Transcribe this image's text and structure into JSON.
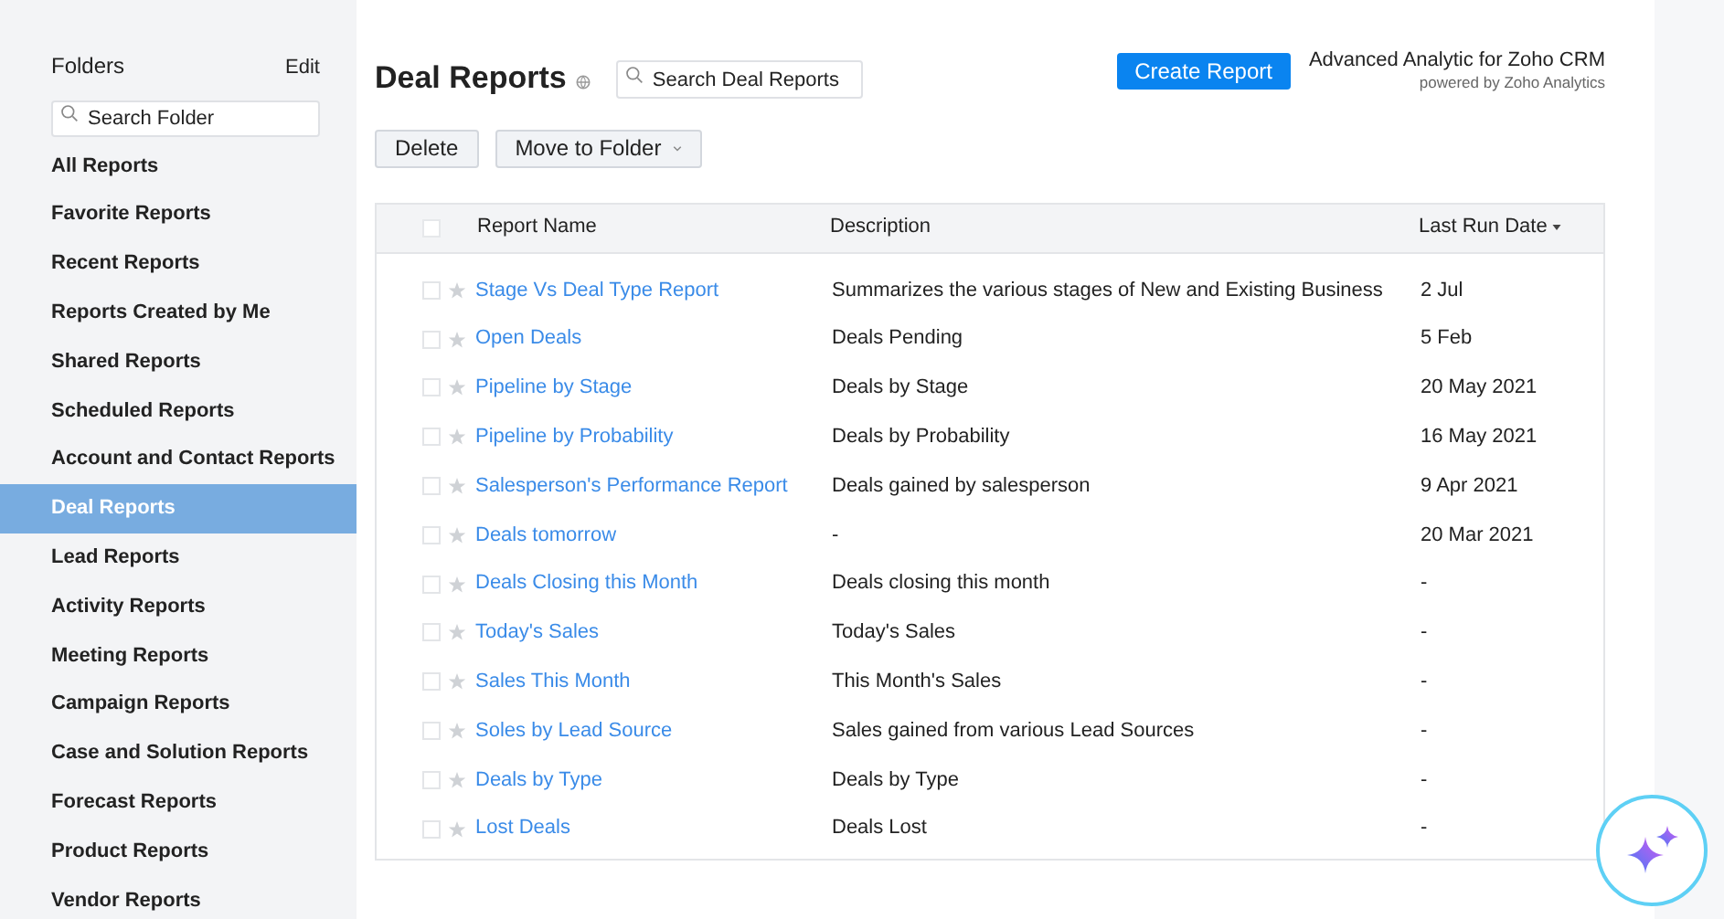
{
  "sidebar": {
    "title": "Folders",
    "edit": "Edit",
    "search": {
      "placeholder": "Search Folder"
    },
    "items": [
      {
        "label": "All Reports",
        "selected": false
      },
      {
        "label": "Favorite Reports",
        "selected": false
      },
      {
        "label": "Recent Reports",
        "selected": false
      },
      {
        "label": "Reports Created by Me",
        "selected": false
      },
      {
        "label": "Shared Reports",
        "selected": false
      },
      {
        "label": "Scheduled Reports",
        "selected": false
      },
      {
        "label": "Account and Contact Reports",
        "selected": false
      },
      {
        "label": "Deal Reports",
        "selected": true
      },
      {
        "label": "Lead Reports",
        "selected": false
      },
      {
        "label": "Activity Reports",
        "selected": false
      },
      {
        "label": "Meeting Reports",
        "selected": false
      },
      {
        "label": "Campaign Reports",
        "selected": false
      },
      {
        "label": "Case and Solution Reports",
        "selected": false
      },
      {
        "label": "Forecast Reports",
        "selected": false
      },
      {
        "label": "Product Reports",
        "selected": false
      },
      {
        "label": "Vendor Reports",
        "selected": false
      }
    ]
  },
  "header": {
    "title": "Deal Reports",
    "search": {
      "placeholder": "Search Deal Reports"
    },
    "create_button": "Create Report",
    "promo_title": "Advanced Analytic for Zoho CRM",
    "promo_subtitle": "powered by Zoho Analytics"
  },
  "toolbar": {
    "buttons": [
      "Delete",
      "Move to Folder"
    ]
  },
  "table": {
    "header_checked": false,
    "columns": [
      "Report Name",
      "Description",
      "Last Run Date"
    ],
    "rows": [
      {
        "name": "Stage Vs Deal Type Report",
        "description": "Summarizes the various stages of New and Existing Business",
        "last_run": "2 Jul",
        "checked": false
      },
      {
        "name": "Open Deals",
        "description": "Deals Pending",
        "last_run": "5 Feb",
        "checked": false
      },
      {
        "name": "Pipeline by Stage",
        "description": "Deals by Stage",
        "last_run": "20 May 2021",
        "checked": false
      },
      {
        "name": "Pipeline by Probability",
        "description": "Deals by Probability",
        "last_run": "16 May 2021",
        "checked": false
      },
      {
        "name": "Salesperson's Performance Report",
        "description": "Deals gained by salesperson",
        "last_run": "9 Apr 2021",
        "checked": false
      },
      {
        "name": "Deals tomorrow",
        "description": "-",
        "last_run": "20 Mar 2021",
        "checked": false
      },
      {
        "name": "Deals Closing this Month",
        "description": "Deals closing this month",
        "last_run": "-",
        "checked": false
      },
      {
        "name": "Today's Sales",
        "description": "Today's Sales",
        "last_run": "-",
        "checked": false
      },
      {
        "name": "Sales This Month",
        "description": "This Month's Sales",
        "last_run": "-",
        "checked": false
      },
      {
        "name": "Soles by Lead Source",
        "description": "Sales gained from various Lead Sources",
        "last_run": "-",
        "checked": false
      },
      {
        "name": "Deals by Type",
        "description": "Deals by Type",
        "last_run": "-",
        "checked": false
      },
      {
        "name": "Lost Deals",
        "description": "Deals Lost",
        "last_run": "-",
        "checked": false
      }
    ]
  }
}
